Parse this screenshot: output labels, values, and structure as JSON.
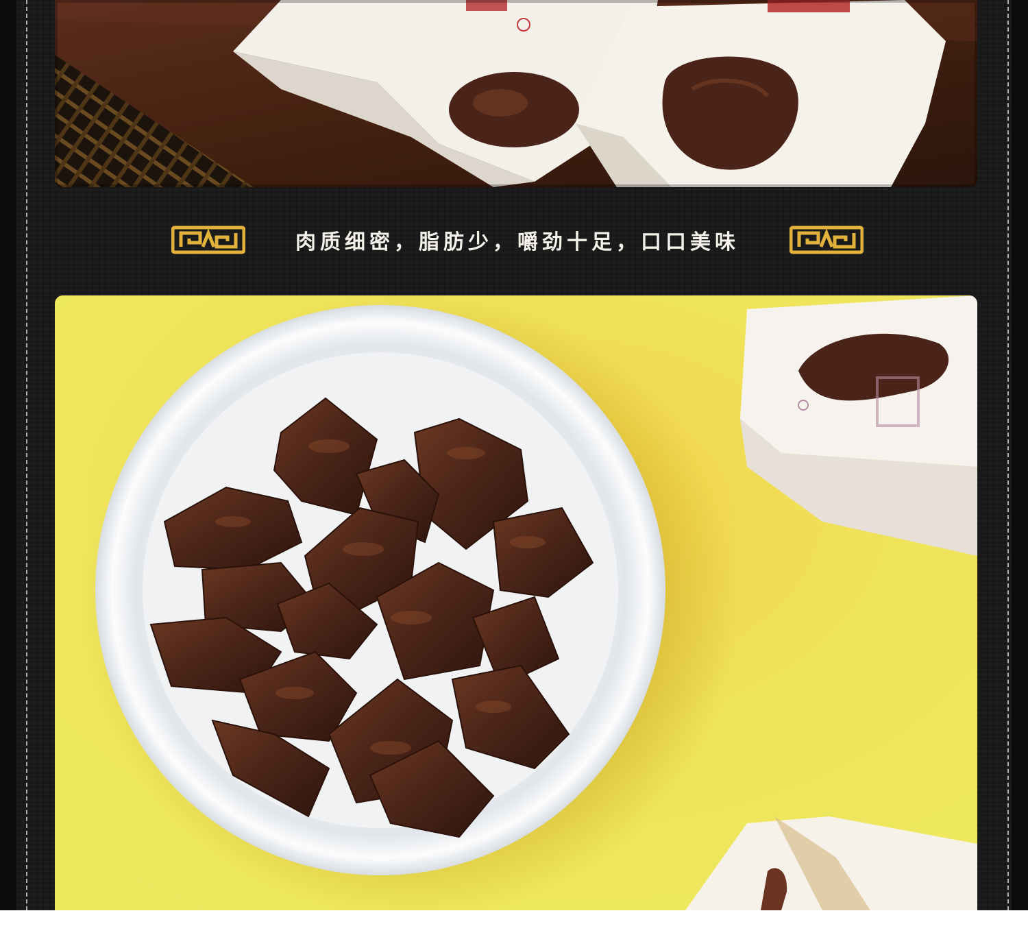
{
  "banner": {
    "slogan": "肉质细密，脂肪少，嚼劲十足，口口美味"
  },
  "colors": {
    "board": "#1a1a1b",
    "stitch": "#e6e6e6",
    "ornament": "#e3b23c",
    "slogan": "#f4f1ea",
    "yellow_backdrop": "#efe65a",
    "wood": "#3a1c14",
    "meat": "#4a2418"
  },
  "images": {
    "top_photo": "wrapped-beef-jerky-packets-on-wooden-board",
    "bottom_photo": "bowl-of-braised-beef-cubes-on-yellow-background"
  }
}
